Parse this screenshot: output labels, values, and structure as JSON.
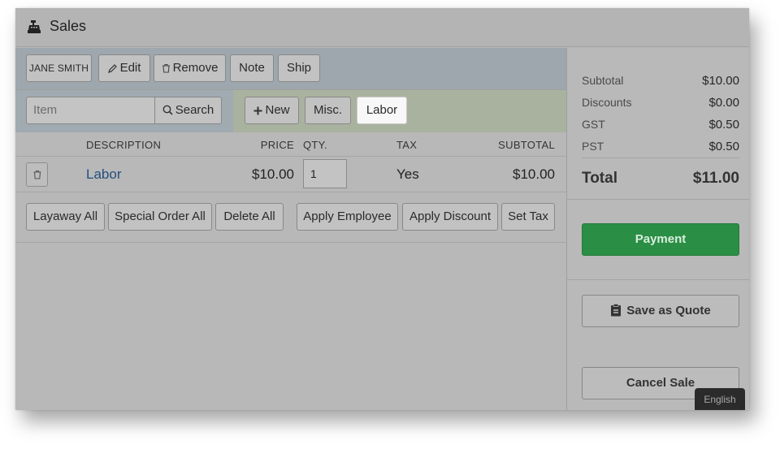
{
  "window": {
    "title": "Sales",
    "icon": "cash-register-icon"
  },
  "customer": {
    "name": "JANE SMITH",
    "edit_label": "Edit",
    "remove_label": "Remove",
    "note_label": "Note",
    "ship_label": "Ship"
  },
  "search": {
    "placeholder": "Item",
    "search_label": "Search",
    "new_label": "New",
    "misc_label": "Misc.",
    "labor_label": "Labor"
  },
  "table": {
    "headers": {
      "description": "DESCRIPTION",
      "price": "PRICE",
      "qty": "QTY.",
      "tax": "TAX",
      "subtotal": "SUBTOTAL"
    },
    "rows": [
      {
        "description": "Labor",
        "price": "$10.00",
        "qty": "1",
        "tax": "Yes",
        "subtotal": "$10.00"
      }
    ]
  },
  "actions": {
    "layaway_all": "Layaway All",
    "special_order_all": "Special Order All",
    "delete_all": "Delete All",
    "apply_employee": "Apply Employee",
    "apply_discount": "Apply Discount",
    "set_tax": "Set Tax"
  },
  "totals": {
    "subtotal_label": "Subtotal",
    "subtotal": "$10.00",
    "discounts_label": "Discounts",
    "discounts": "$0.00",
    "gst_label": "GST",
    "gst": "$0.50",
    "pst_label": "PST",
    "pst": "$0.50",
    "total_label": "Total",
    "total": "$11.00"
  },
  "side_buttons": {
    "payment": "Payment",
    "save_quote": "Save as Quote",
    "cancel_sale": "Cancel Sale"
  },
  "language": "English",
  "colors": {
    "payment_green": "#2a8e45",
    "link_blue": "#24507f",
    "customer_bar": "#9ea7ad",
    "add_bar": "#a9b29f"
  }
}
